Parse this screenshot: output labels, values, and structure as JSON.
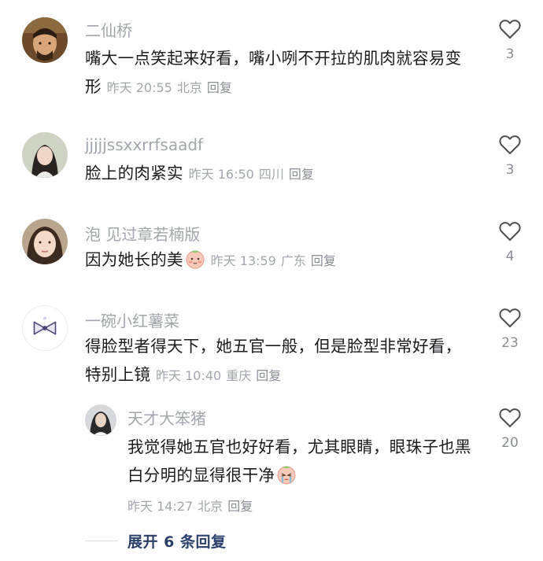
{
  "comments": [
    {
      "username": "二仙桥",
      "text": "嘴大一点笑起来好看，嘴小咧不开拉的肌肉就容易变形",
      "time": "昨天 20:55",
      "location": "北京",
      "reply_label": "回复",
      "likes": "3",
      "avatar_icon": "avatar-man-icon"
    },
    {
      "username": "jjjjjssxxrrfsaadf",
      "text": "脸上的肉紧实",
      "time": "昨天 16:50",
      "location": "四川",
      "reply_label": "回复",
      "likes": "3",
      "avatar_icon": "avatar-woman-icon"
    },
    {
      "username": "泡 见过章若楠版",
      "text": "因为她长的美",
      "emoji": "blush-face-emoji",
      "time": "昨天 13:59",
      "location": "广东",
      "reply_label": "回复",
      "likes": "4",
      "avatar_icon": "avatar-woman-icon"
    },
    {
      "username": "一碗小红薯菜",
      "text": "得脸型者得天下，她五官一般，但是脸型非常好看，特别上镜",
      "time": "昨天 10:40",
      "location": "重庆",
      "reply_label": "回复",
      "likes": "23",
      "avatar_icon": "bow-icon"
    }
  ],
  "reply": {
    "username": "天才大笨猪",
    "text": "我觉得她五官也好好看，尤其眼睛，眼珠子也黑白分明的显得很干净",
    "emoji": "crying-face-emoji",
    "time": "昨天 14:27",
    "location": "北京",
    "reply_label": "回复",
    "likes": "20",
    "avatar_icon": "avatar-woman-icon"
  },
  "expand_label": "展开 6 条回复",
  "colors": {
    "username": "#a2a6ad",
    "body_text": "#1b1b1f",
    "expand": "#2b3f6b"
  }
}
